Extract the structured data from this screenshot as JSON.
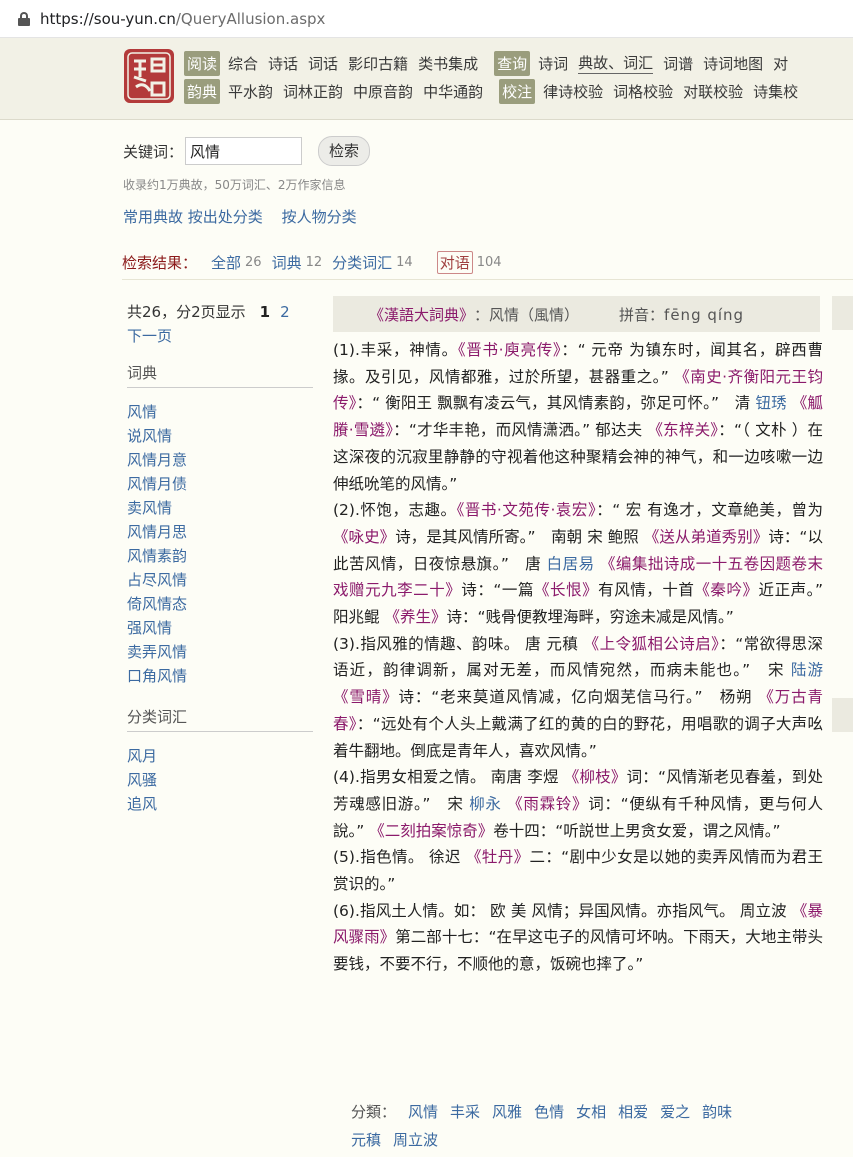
{
  "browser": {
    "url_host": "https://sou-yun.cn",
    "url_path": "/QueryAllusion.aspx"
  },
  "nav": {
    "row1": {
      "tag1": "阅读",
      "items1": [
        "综合",
        "诗话",
        "词话",
        "影印古籍",
        "类书集成"
      ],
      "tag2": "查询",
      "items2": [
        "诗词",
        "典故、词汇",
        "词谱",
        "诗词地图",
        "对"
      ]
    },
    "row2": {
      "tag1": "韵典",
      "items1": [
        "平水韵",
        "词林正韵",
        "中原音韵",
        "中华通韵"
      ],
      "tag2": "校注",
      "items2": [
        "律诗校验",
        "词格校验",
        "对联校验",
        "诗集校"
      ]
    }
  },
  "search": {
    "label": "关键词：",
    "value": "风情",
    "button": "检索",
    "stats": "收录约1万典故，50万词汇、2万作家信息",
    "link1": "常用典故 按出处分类",
    "link2": "按人物分类"
  },
  "result_tabs": {
    "label": "检索结果：",
    "tabs": [
      {
        "label": "全部",
        "count": "26"
      },
      {
        "label": "词典",
        "count": "12"
      },
      {
        "label": "分类词汇",
        "count": "14"
      },
      {
        "label": "对语",
        "count": "104"
      }
    ]
  },
  "sidebar": {
    "pager_info": "共26，分2页显示",
    "current_page": "1",
    "page2": "2",
    "next": "下一页",
    "dict_head": "词典",
    "dict_items": [
      "风情",
      "说风情",
      "风情月意",
      "风情月债",
      "卖风情",
      "风情月思",
      "风情素韵",
      "占尽风情",
      "倚风情态",
      "强风情",
      "卖弄风情",
      "口角风情"
    ],
    "cat_head": "分类词汇",
    "cat_items": [
      "风月",
      "风骚",
      "追风"
    ]
  },
  "entry": {
    "book": "《漢語大詞典》",
    "word": "：风情（風情）",
    "pinyin_label": "拼音：",
    "pinyin": "fēng qíng",
    "p1": {
      "a": "(1).丰采，神情。",
      "b1": "《晋书·庾亮传》",
      "c": "：“ 元帝 为镇东时，闻其名，辟西曹掾。及引见，风情都雅，过於所望，甚器重之。” ",
      "b2": "《南史·齐衡阳元王钧传》",
      "d": "：“ 衡阳王 飘飘有凌云气，其风情素韵，弥足可怀。”　清 ",
      "au1": "钮琇",
      "b3": " 《觚賸·雪遴》",
      "e": "：“才华丰艳，而风情潇洒。” 郁达夫 ",
      "b4": "《东梓关》",
      "f": "：“（ 文朴 ）在这深夜的沉寂里静静的守视着他这种聚精会神的神气，和一边咳嗽一边伸纸吮笔的风情。”"
    },
    "p2": {
      "a": "(2).怀饱，志趣。",
      "b1": "《晋书·文苑传·袁宏》",
      "c": "：“ 宏 有逸才，文章絶美，曾为",
      "b2": "《咏史》",
      "d": "诗，是其风情所寄。”　南朝 宋 鲍照 ",
      "b3": "《送从弟道秀别》",
      "e": "诗：“以此苦风情，日夜惊悬旗。”　唐 ",
      "au1": "白居易",
      "b4": " 《编集拙诗成一十五卷因题卷末戏赠元九李二十》",
      "f": "诗：“一篇",
      "b5": "《长恨》",
      "g": "有风情，十首",
      "b6": "《秦吟》",
      "h": "近正声。”　阳兆鲲 ",
      "b7": "《养生》",
      "i": "诗：“贱骨便教埋海畔，穷途未减是风情。”"
    },
    "p3": {
      "a": "(3).指风雅的情趣、韵味。 唐 元稹 ",
      "b1": "《上令狐相公诗启》",
      "c": "：“常欲得思深语近，韵律调新，属对无差，而风情宛然，而病未能也。”　宋 ",
      "au1": "陆游",
      "b2": " 《雪晴》",
      "d": "诗：“老来莫道风情减，亿向烟芜信马行。”　杨朔 ",
      "b3": "《万古青春》",
      "e": "：“远处有个人头上戴满了红的黄的白的野花，用唱歌的调子大声吆着牛翻地。倒底是青年人，喜欢风情。”"
    },
    "p4": {
      "a": "(4).指男女相爱之情。 南唐 李煜 ",
      "b1": "《柳枝》",
      "c": "词：“风情渐老见春羞，到处芳魂感旧游。”　宋 ",
      "au1": "柳永",
      "b2": " 《雨霖铃》",
      "d": "词：“便纵有千种风情，更与何人說。” ",
      "b3": "《二刻拍案惊奇》",
      "e": "卷十四：“听説世上男贪女爱，谓之风情。”"
    },
    "p5": {
      "a": "(5).指色情。 徐迟 ",
      "b1": "《牡丹》",
      "c": "二：“剧中少女是以她的卖弄风情而为君王赏识的。”"
    },
    "p6": {
      "a": "(6).指风土人情。如： 欧 美 风情；异国风情。亦指风气。 周立波 ",
      "b1": "《暴风骤雨》",
      "c": "第二部十七：“在早这屯子的风情可坏呐。下雨天，大地主带头要钱，不要不行，不顺他的意，饭碗也摔了。”"
    },
    "categories_label": "分類：",
    "categories": [
      "风情",
      "丰采",
      "风雅",
      "色情",
      "女相",
      "相爱",
      "爱之",
      "韵味",
      "元稹",
      "周立波"
    ]
  }
}
